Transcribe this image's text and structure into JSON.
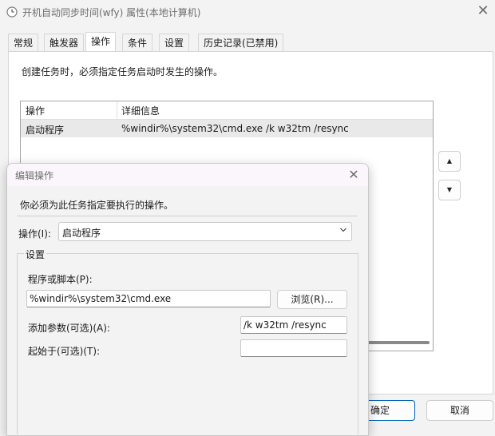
{
  "window": {
    "title": "开机自动同步时间(wfy) 属性(本地计算机)",
    "icon": "clock-icon",
    "close_glyph": "✕"
  },
  "tabs": [
    {
      "label": "常规",
      "active": false
    },
    {
      "label": "触发器",
      "active": false
    },
    {
      "label": "操作",
      "active": true
    },
    {
      "label": "条件",
      "active": false
    },
    {
      "label": "设置",
      "active": false
    },
    {
      "label": "历史记录(已禁用)",
      "active": false
    }
  ],
  "actions_panel": {
    "intro": "创建任务时，必须指定任务启动时发生的操作。",
    "columns": [
      "操作",
      "详细信息"
    ],
    "rows": [
      {
        "action": "启动程序",
        "details": "%windir%\\system32\\cmd.exe /k w32tm /resync"
      }
    ],
    "move_up_glyph": "▲",
    "move_down_glyph": "▼"
  },
  "footer": {
    "ok_label": "确定",
    "cancel_label": "取消"
  },
  "dialog": {
    "title": "编辑操作",
    "close_glyph": "✕",
    "prompt": "你必须为此任务指定要执行的操作。",
    "action_label": "操作(I):",
    "action_value": "启动程序",
    "settings_group": "设置",
    "program_label": "程序或脚本(P):",
    "program_value": "%windir%\\system32\\cmd.exe",
    "browse_label": "浏览(R)...",
    "args_label": "添加参数(可选)(A):",
    "args_value": "/k w32tm /resync",
    "start_in_label": "起始于(可选)(T):",
    "start_in_value": ""
  },
  "colors": {
    "accent": "#005fb8",
    "selected_row": "#e9e9e9"
  }
}
